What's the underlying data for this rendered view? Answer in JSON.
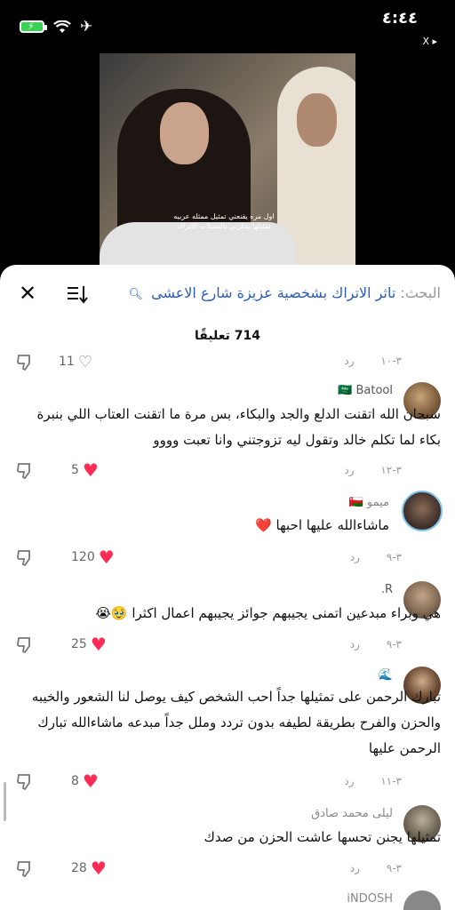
{
  "status": {
    "time": "٤:٤٤",
    "ad_label": "X ▸"
  },
  "video": {
    "caption": "اول مره يقنعني تمثيل ممثله عربيه تمثيلها يذكرني بالممثلات الاتراك"
  },
  "search": {
    "prefix": "البحث:",
    "query": "تاثر الاتراك بشخصية عزيزة شارع الاعشى"
  },
  "comments_count": "714 تعليقًا",
  "comments": [
    {
      "author": "",
      "body": "",
      "likes": "11",
      "date": "٣-١٠",
      "reply": "رد"
    },
    {
      "author": "🇸🇦 Batool",
      "body": "سبحان الله اتقنت الدلع والجد والبكاء، بس مرة ما اتقنت العتاب اللي بنبرة بكاء لما تكلم خالد وتقول ليه تزوجتني وانا تعبت وووو",
      "likes": "5",
      "date": "٣-١٢",
      "reply": "رد"
    },
    {
      "author": "ميمو 🇴🇲",
      "body": "ماشاءالله عليها احبها ❤️",
      "likes": "120",
      "date": "٣-٩",
      "reply": "رد"
    },
    {
      "author": "R.",
      "body": "هي وبراء مبدعين اتمنى يجيبهم جوائز يجيبهم اعمال اكثرا 🥹😭",
      "likes": "25",
      "date": "٣-٩",
      "reply": "رد"
    },
    {
      "author": "🌊",
      "body": "تبارك الرحمن على تمثيلها جداً احب الشخص كيف يوصل لنا الشعور والخيبه والحزن والفرح بطريقة لطيفه بدون تردد وملل جداً مبدعه ماشاءالله تبارك الرحمن عليها",
      "likes": "8",
      "date": "٣-١١",
      "reply": "رد"
    },
    {
      "author": "ليلى محمد صادق",
      "body": "تمثيلها يجنن تحسها عاشت الحزن من صدك",
      "likes": "28",
      "date": "٣-٩",
      "reply": "رد"
    },
    {
      "author": "iNDOSH",
      "body": "",
      "likes": "",
      "date": "",
      "reply": ""
    }
  ],
  "colors": {
    "accent": "#2b5bbd",
    "heart": "#ff2d55",
    "battery": "#39d353"
  },
  "icons": [
    "battery-icon",
    "wifi-icon",
    "airplane-icon",
    "close-icon",
    "sort-icon",
    "search-icon",
    "dislike-icon",
    "heart-icon"
  ]
}
